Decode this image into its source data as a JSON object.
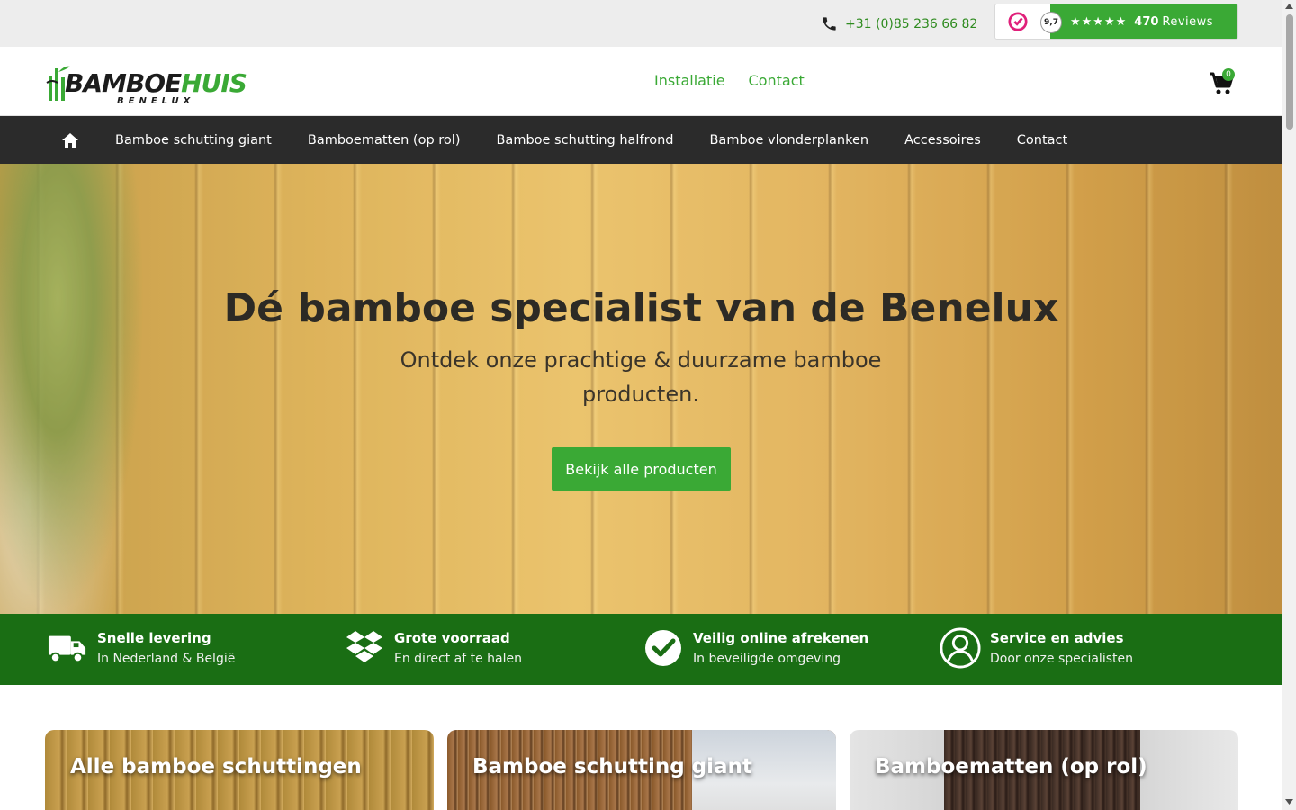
{
  "topbar": {
    "phone": "+31 (0)85 236 66 82",
    "review_score": "9,7",
    "review_stars": "★★★★★",
    "review_count": "470",
    "review_label": "Reviews"
  },
  "header": {
    "logo_main": "BAMBOE",
    "logo_accent": "HUIS",
    "logo_sub": "BENELUX",
    "nav": [
      "Installatie",
      "Contact"
    ],
    "cart_count": "0"
  },
  "mainnav": {
    "items": [
      "Bamboe schutting giant",
      "Bamboematten (op rol)",
      "Bamboe schutting halfrond",
      "Bamboe vlonderplanken",
      "Accessoires",
      "Contact"
    ]
  },
  "hero": {
    "title": "Dé bamboe specialist van de Benelux",
    "subtitle": "Ontdek onze prachtige & duurzame bamboe producten.",
    "button": "Bekijk alle producten"
  },
  "usp": [
    {
      "icon": "truck-icon",
      "title": "Snelle levering",
      "text": "In Nederland & België"
    },
    {
      "icon": "dropbox-icon",
      "title": "Grote voorraad",
      "text": "En direct af te halen"
    },
    {
      "icon": "check-circle-icon",
      "title": "Veilig online afrekenen",
      "text": "In beveiligde omgeving"
    },
    {
      "icon": "user-circle-icon",
      "title": "Service en advies",
      "text": "Door onze specialisten"
    }
  ],
  "categories": [
    "Alle bamboe schuttingen",
    "Bamboe schutting giant",
    "Bamboematten (op rol)"
  ],
  "colors": {
    "brand_green": "#3aa935",
    "usp_green": "#1a6e14",
    "nav_dark": "#2b2b2b"
  }
}
